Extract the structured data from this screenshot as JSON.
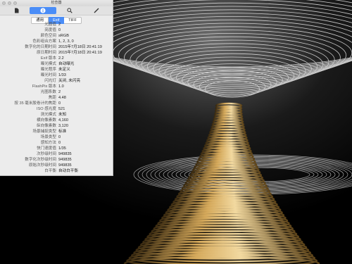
{
  "window": {
    "title": "检查器"
  },
  "toolbar": {
    "items": [
      {
        "name": "general-info",
        "icon": "document-icon"
      },
      {
        "name": "more-info",
        "icon": "info-icon",
        "active": true
      },
      {
        "name": "search",
        "icon": "magnifier-icon"
      },
      {
        "name": "annotate",
        "icon": "pen-icon"
      }
    ]
  },
  "tabs": [
    {
      "label": "通用",
      "selected": false
    },
    {
      "label": "Exif",
      "selected": true
    },
    {
      "label": "TIFF",
      "selected": false
    }
  ],
  "exif_rows": [
    {
      "label": "光圈值",
      "value": "2"
    },
    {
      "label": "亮度值",
      "value": "0"
    },
    {
      "label": "颜色空间",
      "value": "sRGB"
    },
    {
      "label": "色彩组合方案",
      "value": "1, 2, 3, 0"
    },
    {
      "label": "数字化的日期时间",
      "value": "2015年7月18日 20:41:19"
    },
    {
      "label": "原日期时间",
      "value": "2015年7月18日 20:41:19"
    },
    {
      "label": "Exif 版本",
      "value": "2.2"
    },
    {
      "label": "曝光模式",
      "value": "自动曝光"
    },
    {
      "label": "曝光程序",
      "value": "未定义"
    },
    {
      "label": "曝光时间",
      "value": "1/33"
    },
    {
      "label": "闪光灯",
      "value": "关闭, 未闪亮"
    },
    {
      "label": "FlashPix 版本",
      "value": "1.0"
    },
    {
      "label": "光圈系数",
      "value": "2"
    },
    {
      "label": "焦距",
      "value": "4.48"
    },
    {
      "label": "按 35 毫米胶卷计的焦距",
      "value": "0"
    },
    {
      "label": "ISO 感光度",
      "value": "521"
    },
    {
      "label": "测光模式",
      "value": "未知"
    },
    {
      "label": "横向像素数",
      "value": "4,160"
    },
    {
      "label": "纵向像素数",
      "value": "3,120"
    },
    {
      "label": "场景捕捉类型",
      "value": "标准"
    },
    {
      "label": "场景类型",
      "value": "0"
    },
    {
      "label": "感知方法",
      "value": "0"
    },
    {
      "label": "快门速度值",
      "value": "1/35"
    },
    {
      "label": "次秒级时间",
      "value": "949835"
    },
    {
      "label": "数字化次秒级时间",
      "value": "949835"
    },
    {
      "label": "原始次秒级时间",
      "value": "949835"
    },
    {
      "label": "白平衡",
      "value": "自动白平衡"
    }
  ]
}
